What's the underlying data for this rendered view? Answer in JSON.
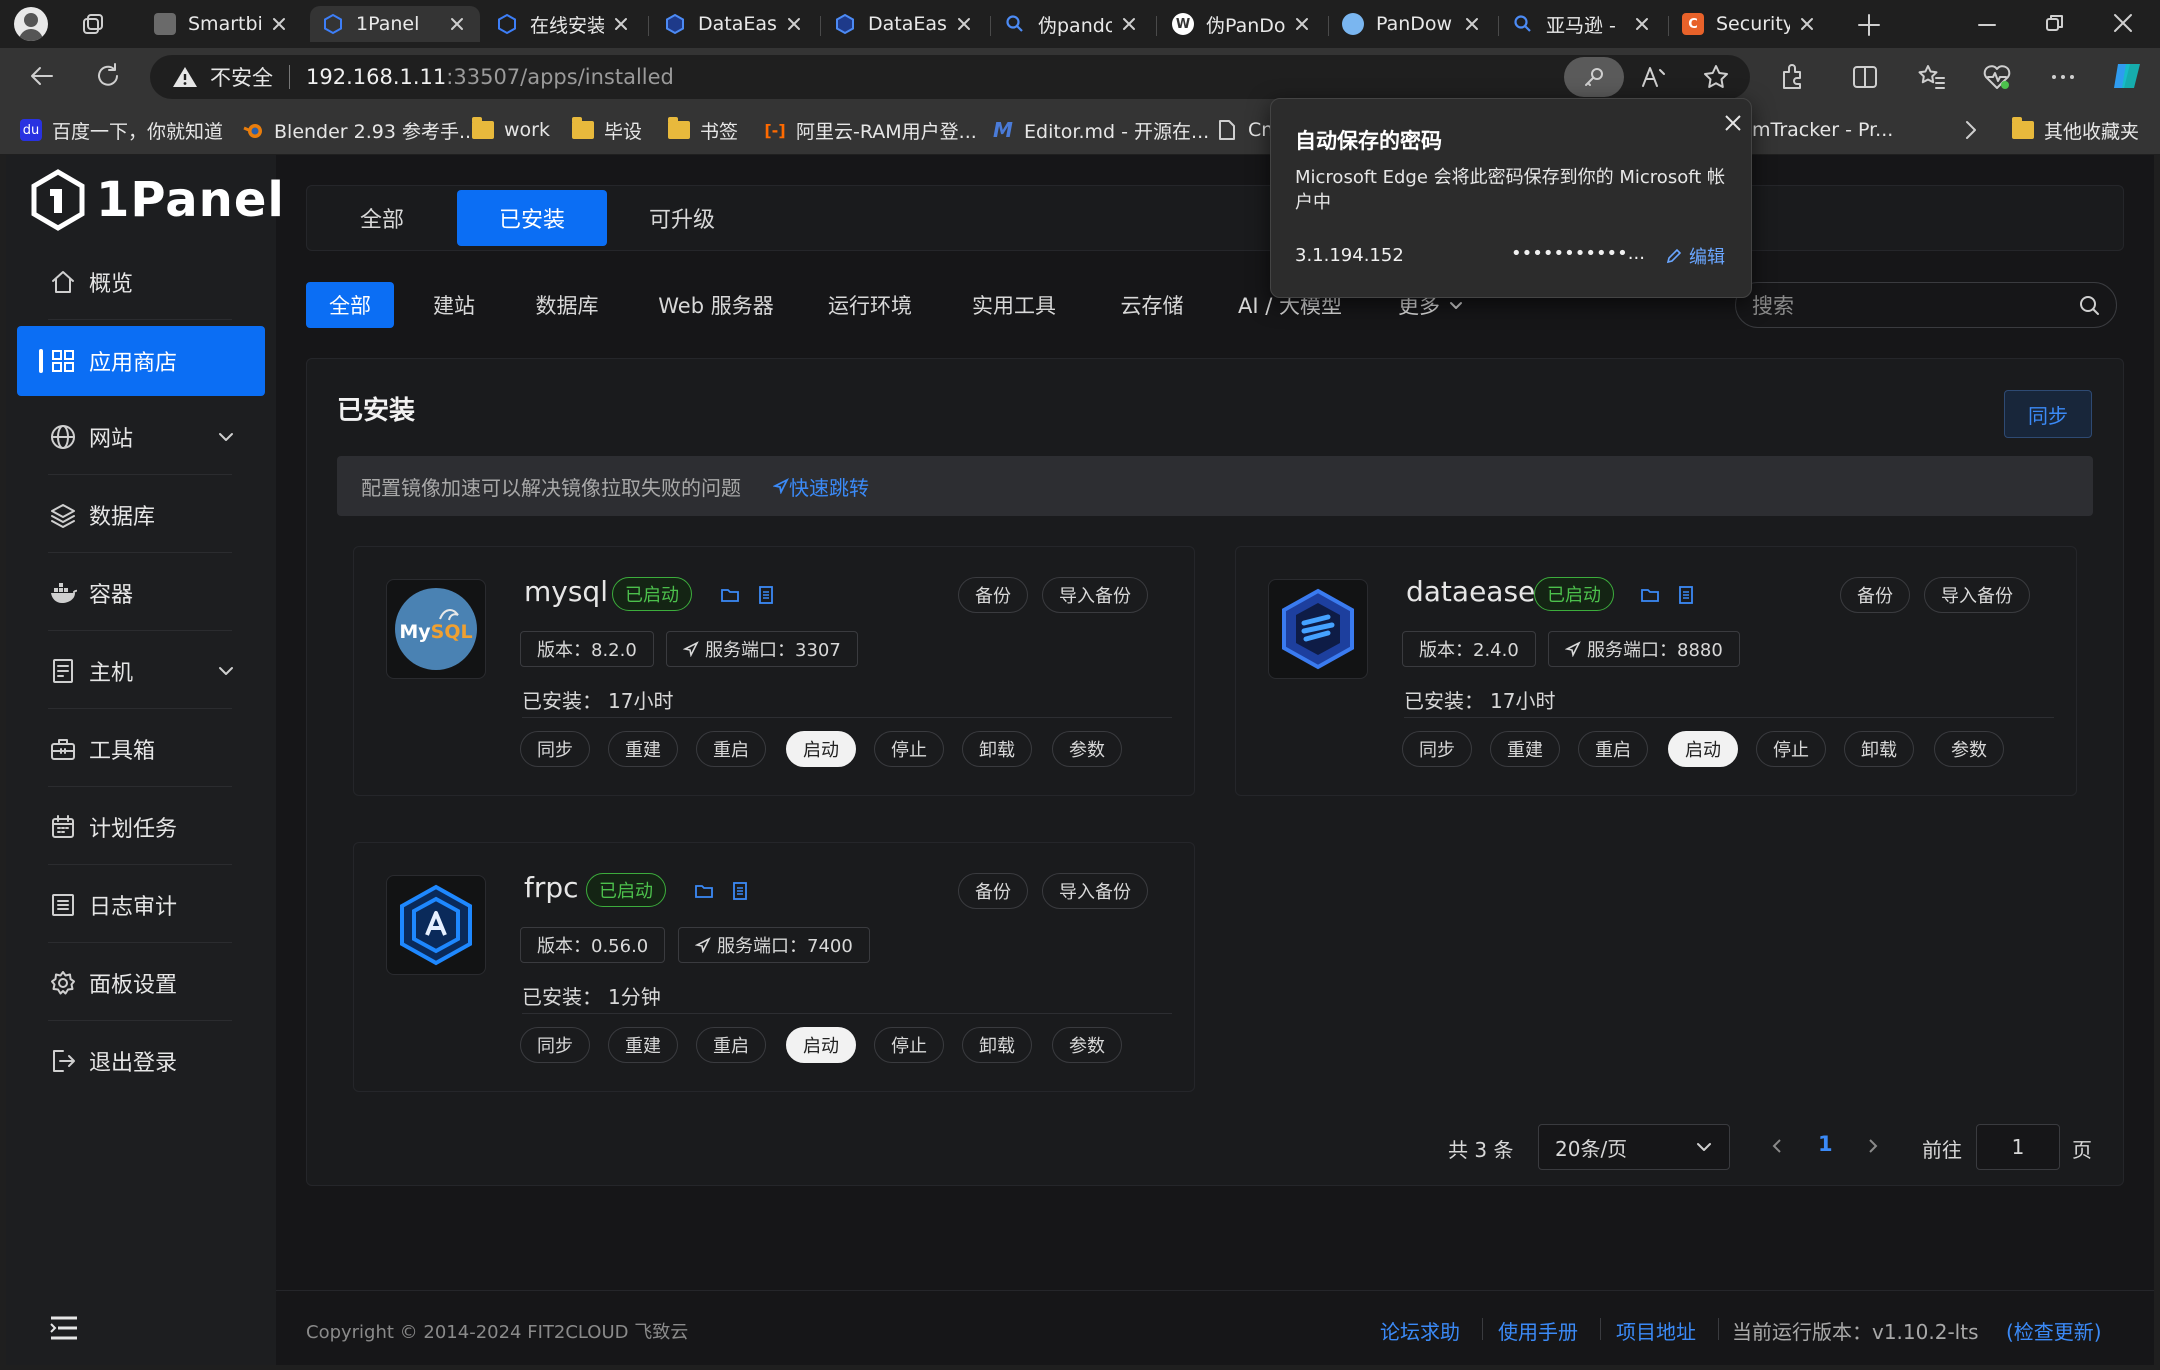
{
  "browser": {
    "tabs": [
      {
        "title": "Smartbi",
        "icon": "smartbi-icon"
      },
      {
        "title": "1Panel",
        "icon": "1panel-icon",
        "active": true
      },
      {
        "title": "在线安装",
        "icon": "1panel-icon"
      },
      {
        "title": "DataEase",
        "icon": "dataease-icon"
      },
      {
        "title": "DataEase",
        "icon": "dataease-icon"
      },
      {
        "title": "伪pando",
        "icon": "search-icon"
      },
      {
        "title": "伪PanDo",
        "icon": "wordpress-icon"
      },
      {
        "title": "PanDow",
        "icon": "cloud-icon"
      },
      {
        "title": "亚马逊 -",
        "icon": "search-icon"
      },
      {
        "title": "Security",
        "icon": "security-icon"
      }
    ],
    "address": {
      "security_label": "不安全",
      "url_host": "192.168.1.11",
      "url_rest": ":33507/apps/installed"
    },
    "bookmarks": [
      {
        "label": "百度一下，你就知道",
        "icon": "baidu-icon"
      },
      {
        "label": "Blender 2.93 参考手...",
        "icon": "blender-icon"
      },
      {
        "label": "work",
        "icon": "folder-icon"
      },
      {
        "label": "毕设",
        "icon": "folder-icon"
      },
      {
        "label": "书签",
        "icon": "folder-icon"
      },
      {
        "label": "阿里云-RAM用户登...",
        "icon": "aliyun-icon"
      },
      {
        "label": "Editor.md - 开源在...",
        "icon": "editormd-icon"
      },
      {
        "label": "Cn",
        "icon": "page-icon"
      },
      {
        "label": "mTracker - Pr...",
        "icon": "page-icon"
      }
    ],
    "other_bookmarks": "其他收藏夹"
  },
  "password_popup": {
    "title": "自动保存的密码",
    "message": "Microsoft Edge 会将此密码保存到你的 Microsoft 帐户中",
    "site": "3.1.194.152",
    "password_mask": "•••••••••••...",
    "edit_label": "编辑"
  },
  "sidebar": {
    "logo_text": "1Panel",
    "items": [
      {
        "label": "概览",
        "icon": "home-icon"
      },
      {
        "label": "应用商店",
        "icon": "apps-grid-icon",
        "active": true
      },
      {
        "label": "网站",
        "icon": "globe-icon",
        "expandable": true
      },
      {
        "label": "数据库",
        "icon": "layers-icon"
      },
      {
        "label": "容器",
        "icon": "docker-icon"
      },
      {
        "label": "主机",
        "icon": "host-icon",
        "expandable": true
      },
      {
        "label": "工具箱",
        "icon": "toolbox-icon"
      },
      {
        "label": "计划任务",
        "icon": "calendar-icon"
      },
      {
        "label": "日志审计",
        "icon": "log-icon"
      },
      {
        "label": "面板设置",
        "icon": "gear-icon"
      },
      {
        "label": "退出登录",
        "icon": "logout-icon"
      }
    ]
  },
  "main": {
    "top_tabs": [
      "全部",
      "已安装",
      "可升级"
    ],
    "categories": [
      "全部",
      "建站",
      "数据库",
      "Web 服务器",
      "运行环境",
      "实用工具",
      "云存储",
      "AI / 大模型",
      "更多"
    ],
    "search_placeholder": "搜索",
    "section_title": "已安装",
    "sync_button": "同步",
    "notice_text": "配置镜像加速可以解决镜像拉取失败的问题",
    "notice_link": "快速跳转",
    "apps": [
      {
        "name": "mysql",
        "status": "已启动",
        "version_label": "版本：8.2.0",
        "port_label": "服务端口：3307",
        "installed_label": "已安装：",
        "installed_time": "17小时",
        "icon": "mysql-icon"
      },
      {
        "name": "dataease",
        "status": "已启动",
        "version_label": "版本：2.4.0",
        "port_label": "服务端口：8880",
        "installed_label": "已安装：",
        "installed_time": "17小时",
        "icon": "dataease-icon"
      },
      {
        "name": "frpc",
        "status": "已启动",
        "version_label": "版本：0.56.0",
        "port_label": "服务端口：7400",
        "installed_label": "已安装：",
        "installed_time": "1分钟",
        "icon": "frpc-icon"
      }
    ],
    "card_top_buttons": [
      "备份",
      "导入备份"
    ],
    "card_actions": [
      "同步",
      "重建",
      "重启",
      "启动",
      "停止",
      "卸载",
      "参数"
    ],
    "pagination": {
      "total_label": "共 3 条",
      "page_size": "20条/页",
      "current_page": "1",
      "goto_label": "前往",
      "goto_value": "1",
      "page_suffix": "页"
    }
  },
  "footer": {
    "copyright": "Copyright © 2014-2024 FIT2CLOUD 飞致云",
    "links": [
      "论坛求助",
      "使用手册",
      "项目地址"
    ],
    "version_label": "当前运行版本：v1.10.2-lts",
    "check_update": "(检查更新)"
  },
  "colors": {
    "accent": "#0b6ef4",
    "running_green": "#4cc04c",
    "link_blue": "#3b8af7"
  }
}
